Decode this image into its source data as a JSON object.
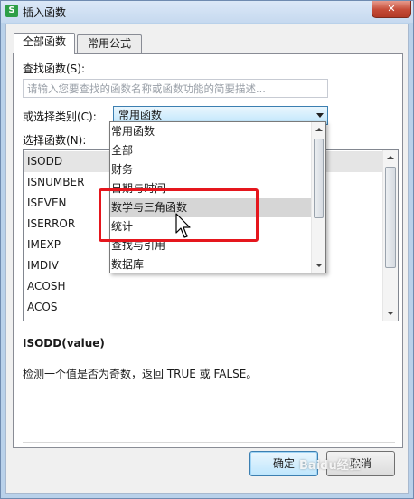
{
  "window": {
    "title": "插入函数",
    "app_icon_letter": "S",
    "close_symbol": "✕"
  },
  "tabs": [
    {
      "label": "全部函数",
      "active": true
    },
    {
      "label": "常用公式",
      "active": false
    }
  ],
  "search": {
    "label": "查找函数(S):",
    "placeholder": "请输入您要查找的函数名称或函数功能的简要描述..."
  },
  "category": {
    "label": "或选择类别(C):",
    "value": "常用函数"
  },
  "functions": {
    "label": "选择函数(N):",
    "items": [
      "ISODD",
      "ISNUMBER",
      "ISEVEN",
      "ISERROR",
      "IMEXP",
      "IMDIV",
      "ACOSH",
      "ACOS"
    ],
    "selected_index": 0
  },
  "dropdown": {
    "items": [
      "常用函数",
      "全部",
      "财务",
      "日期与时间",
      "数学与三角函数",
      "统计",
      "查找与引用",
      "数据库"
    ],
    "highlighted_index": 4
  },
  "selected_function": {
    "signature": "ISODD(value)",
    "description": "检测一个值是否为奇数，返回 TRUE 或 FALSE。"
  },
  "buttons": {
    "ok": "确定",
    "cancel": "取消"
  },
  "watermark": "Baidu经验",
  "colors": {
    "annotation": "#e5161d",
    "selection": "#3c7fb1"
  }
}
